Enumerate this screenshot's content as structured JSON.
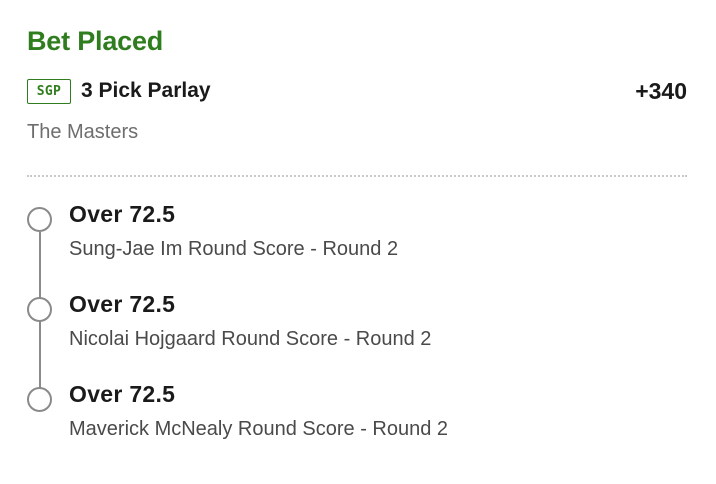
{
  "bet": {
    "status": "Bet Placed",
    "badge": "SGP",
    "type": "3 Pick Parlay",
    "odds": "+340",
    "event": "The Masters"
  },
  "legs": [
    {
      "selection": "Over 72.5",
      "market": "Sung-Jae Im Round Score - Round 2"
    },
    {
      "selection": "Over 72.5",
      "market": "Nicolai Hojgaard Round Score - Round 2"
    },
    {
      "selection": "Over 72.5",
      "market": "Maverick McNealy Round Score - Round 2"
    }
  ],
  "colors": {
    "accent": "#2f7d1e",
    "text": "#1a1a1a",
    "muted": "#6e6e6e",
    "timeline": "#8a8a8a"
  }
}
